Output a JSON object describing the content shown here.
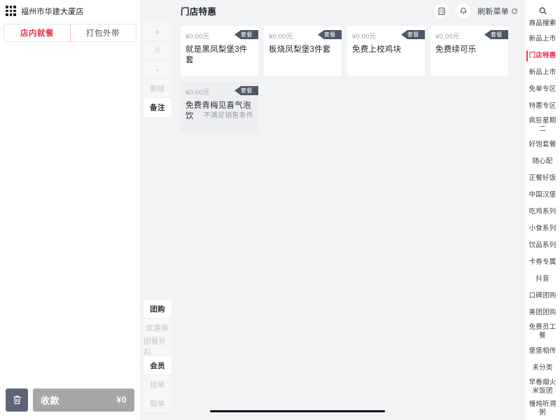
{
  "store": {
    "name": "福州市华建大厦店",
    "apps_icon": "grid-apps-icon",
    "orders_icon": "order-list-icon",
    "bell_icon": "bell-icon"
  },
  "mode_tabs": [
    {
      "label": "店内就餐",
      "active": true
    },
    {
      "label": "打包外带",
      "active": false
    }
  ],
  "numpad": [
    {
      "label": "+",
      "name": "plus",
      "enabled": false
    },
    {
      "label": "0",
      "name": "zero",
      "enabled": false
    },
    {
      "label": "-",
      "name": "minus",
      "enabled": false
    },
    {
      "label": "删除",
      "name": "delete",
      "enabled": false
    },
    {
      "label": "备注",
      "name": "remark",
      "enabled": true
    }
  ],
  "side_actions": [
    {
      "label": "团购",
      "name": "group-buy",
      "enabled": true
    },
    {
      "label": "优惠券",
      "name": "coupon",
      "enabled": false
    },
    {
      "label": "团餐折扣",
      "name": "group-meal-discount",
      "enabled": false
    },
    {
      "label": "会员",
      "name": "member",
      "enabled": true
    },
    {
      "label": "挂单",
      "name": "hold-order",
      "enabled": false
    },
    {
      "label": "取单",
      "name": "retrieve-order",
      "enabled": false
    }
  ],
  "checkout": {
    "trash_icon": "trash-icon",
    "pay_label": "收款",
    "amount": "¥0"
  },
  "main": {
    "section_title": "门店特惠",
    "refresh_label": "刷新菜单",
    "refresh_icon": "refresh-icon"
  },
  "products": [
    {
      "price": "¥0.00元",
      "badge": "套餐",
      "name": "就是黑凤梨堡3件套",
      "disabled": false,
      "note": ""
    },
    {
      "price": "¥0.00元",
      "badge": "套餐",
      "name": "板烧凤梨堡3件套",
      "disabled": false,
      "note": ""
    },
    {
      "price": "¥0.00元",
      "badge": "套餐",
      "name": "免费上校鸡块",
      "disabled": false,
      "note": ""
    },
    {
      "price": "¥0.00元",
      "badge": "套餐",
      "name": "免费续可乐",
      "disabled": false,
      "note": ""
    },
    {
      "price": "¥0.00元",
      "badge": "套餐",
      "name": "免费青梅见喜气泡饮",
      "disabled": true,
      "note": "不满足销售条件"
    }
  ],
  "categories": {
    "search_label": "商品搜索",
    "search_icon": "search-icon",
    "items": [
      {
        "label": "新品上市",
        "active": false
      },
      {
        "label": "门店特惠",
        "active": true
      },
      {
        "label": "新品上市",
        "active": false
      },
      {
        "label": "免单专区",
        "active": false
      },
      {
        "label": "特惠专区",
        "active": false
      },
      {
        "label": "疯狂星期二",
        "active": false
      },
      {
        "label": "好饱套餐",
        "active": false
      },
      {
        "label": "随心配",
        "active": false
      },
      {
        "label": "正餐好饭",
        "active": false
      },
      {
        "label": "中国汉堡",
        "active": false
      },
      {
        "label": "吃鸡系列",
        "active": false
      },
      {
        "label": "小食系列",
        "active": false
      },
      {
        "label": "饮品系列",
        "active": false
      },
      {
        "label": "卡券专属",
        "active": false
      },
      {
        "label": "抖音",
        "active": false
      },
      {
        "label": "口碑团购",
        "active": false
      },
      {
        "label": "美团团购",
        "active": false
      },
      {
        "label": "免费员工餐",
        "active": false
      },
      {
        "label": "堡堡相传",
        "active": false
      },
      {
        "label": "未分类",
        "active": false
      },
      {
        "label": "早春烟火米饭团",
        "active": false
      },
      {
        "label": "慢炖听溯粥",
        "active": false
      }
    ]
  }
}
